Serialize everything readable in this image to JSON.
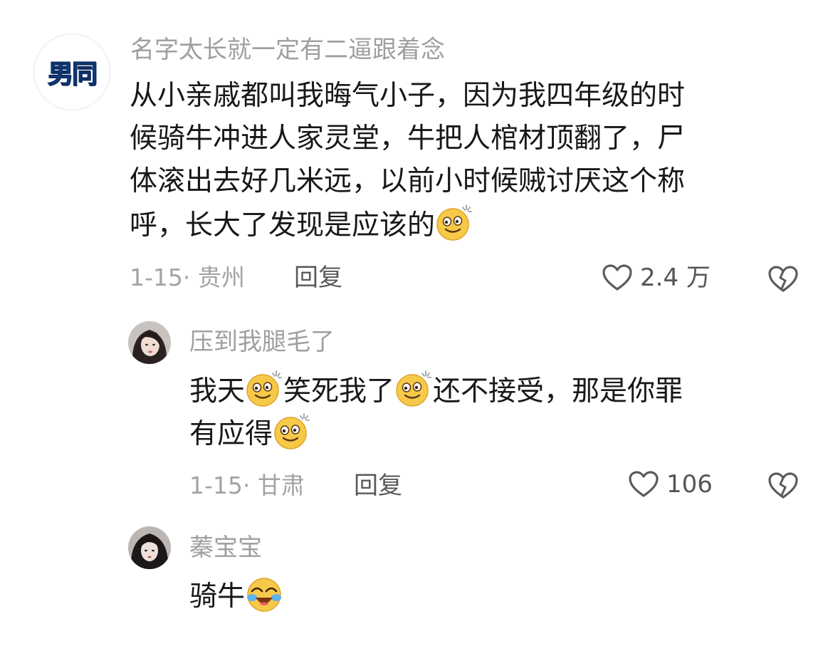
{
  "comment": {
    "avatar_text": "男同",
    "username": "名字太长就一定有二逼跟着念",
    "lines": [
      "从小亲戚都叫我晦气小子，因为我四年级的时",
      "候骑牛冲进人家灵堂，牛把人棺材顶翻了，尸",
      "体滚出去好几米远，以前小时候贼讨厌这个称",
      "呼，长大了发现是应该的"
    ],
    "meta": "1-15· 贵州",
    "reply_label": "回复",
    "likes": "2.4 万"
  },
  "replies": [
    {
      "username": "压到我腿毛了",
      "line1_a": "我天",
      "line1_b": "笑死我了",
      "line1_c": "还不接受，那是你罪",
      "line2": "有应得",
      "meta": "1-15· 甘肃",
      "reply_label": "回复",
      "likes": "106"
    },
    {
      "username": "蓁宝宝",
      "text": "骑牛"
    }
  ],
  "icons": {
    "emoji_smile": "dizzy-smile-emoji",
    "emoji_cry": "laugh-cry-emoji",
    "like": "heart-outline-icon",
    "dislike": "broken-heart-icon"
  },
  "colors": {
    "emoji_yellow": "#f7c948",
    "username_gray": "#9f9f9f",
    "avatar_blue": "#1f6fe0"
  }
}
